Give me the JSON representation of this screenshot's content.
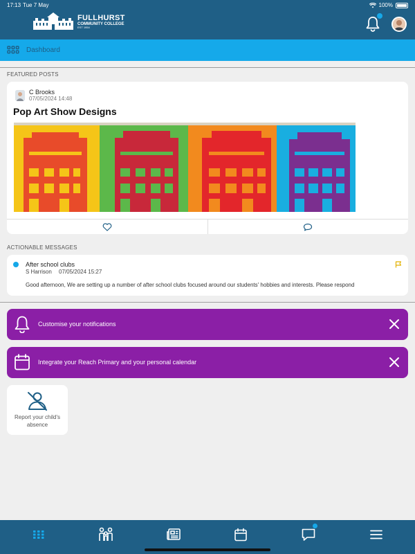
{
  "status": {
    "time": "17:13",
    "date": "Tue 7 May",
    "battery": "100%"
  },
  "header": {
    "logo_name": "FULLHURST",
    "logo_sub": "COMMUNITY COLLEGE",
    "logo_est": "EST 1954"
  },
  "breadcrumb": {
    "label": "Dashboard"
  },
  "featured": {
    "section_label": "FEATURED POSTS",
    "post": {
      "author": "C Brooks",
      "date": "07/05/2024 14:48",
      "title": "Pop Art Show Designs",
      "image_panels": [
        "#f5c518",
        "#5cb84a",
        "#f28a1e",
        "#19aee0"
      ]
    }
  },
  "actionable": {
    "section_label": "ACTIONABLE MESSAGES",
    "message": {
      "title": "After school clubs",
      "sender": "S Harrison",
      "date": "07/05/2024 15:27",
      "body": "Good afternoon, We are setting up a number of after school clubs focused around our students' hobbies and interests. Please respond"
    }
  },
  "banners": [
    {
      "text": "Customise your notifications",
      "icon": "bell-icon"
    },
    {
      "text": "Integrate your Reach Primary and your personal calendar",
      "icon": "calendar-icon"
    }
  ],
  "tiles": [
    {
      "label": "Report your child's absence",
      "icon": "absence-icon"
    }
  ],
  "nav": [
    "dashboard-icon",
    "family-icon",
    "news-icon",
    "calendar-icon",
    "messages-icon",
    "menu-icon"
  ],
  "colors": {
    "header": "#1f5f86",
    "accent": "#15a9ea",
    "banner": "#8b1fa6",
    "flag": "#e2b100"
  }
}
